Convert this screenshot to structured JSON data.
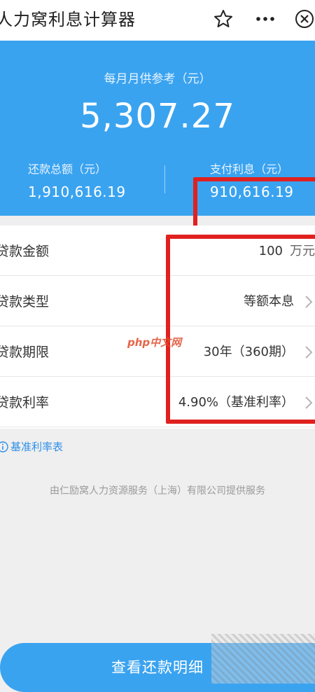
{
  "app": {
    "title": "人力窝利息计算器"
  },
  "icons": {
    "star": "star-icon",
    "more": "more-icon",
    "close": "close-icon",
    "chevron": "chevron-right-icon",
    "info": "info-icon"
  },
  "summary": {
    "monthly_label": "每月月供参考（元）",
    "monthly_amount": "5,307.27",
    "total_label": "还款总额（元）",
    "total_value": "1,910,616.19",
    "interest_label": "支付利息（元）",
    "interest_value": "910,616.19"
  },
  "form": {
    "rows": [
      {
        "name": "贷款金额",
        "value": "100",
        "unit": "万元"
      },
      {
        "name": "贷款类型",
        "value": "等额本息"
      },
      {
        "name": "贷款期限",
        "value": "30年（360期）"
      },
      {
        "name": "贷款利率",
        "value": "4.90%（基准利率）"
      }
    ]
  },
  "rate_table_link": "基准利率表",
  "footer_note": "由仁励窝人力资源服务（上海）有限公司提供服务",
  "detail_button": "查看还款明细",
  "watermark_logo": "php中文网",
  "colors": {
    "accent": "#3aa3f0",
    "highlight": "#e0211f",
    "link": "#2f90e8"
  }
}
